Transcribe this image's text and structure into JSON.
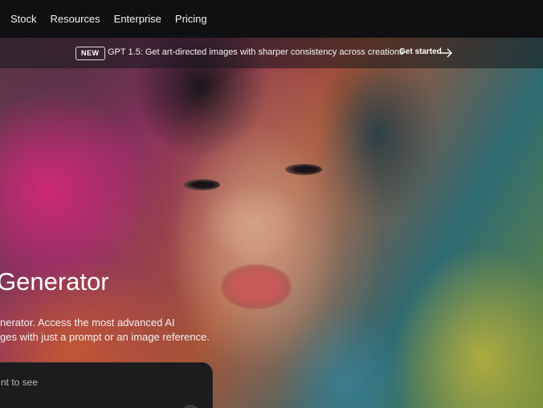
{
  "nav": {
    "items": [
      {
        "label": "Stock"
      },
      {
        "label": "Resources"
      },
      {
        "label": "Enterprise"
      },
      {
        "label": "Pricing"
      }
    ]
  },
  "announcement": {
    "badge": "NEW",
    "message": "GPT 1.5: Get art-directed images with sharper consistency across creations",
    "cta": "Get started",
    "cta_icon": "arrow-right-icon"
  },
  "hero": {
    "title": "Generator",
    "description_line1": "nerator. Access the most advanced AI",
    "description_line2": "ges with just a prompt or an image reference.",
    "prompt_placeholder": "nt to see"
  },
  "colors": {
    "nav_bg": "#101012",
    "prompt_bg": "#1c1c1f"
  }
}
